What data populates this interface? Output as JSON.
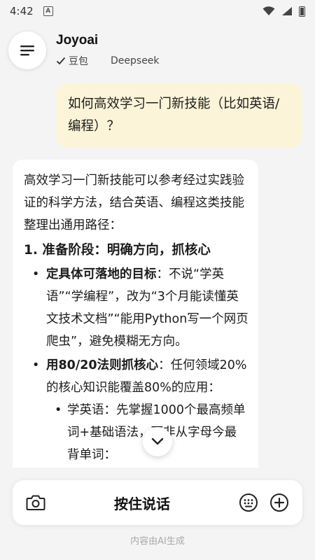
{
  "status_bar": {
    "time": "4:42",
    "notif_letter": "A"
  },
  "header": {
    "title": "Joyoai",
    "models": [
      {
        "label": "豆包",
        "selected": true
      },
      {
        "label": "Deepseek",
        "selected": false
      }
    ]
  },
  "conversation": {
    "user_message": "如何高效学习一门新技能（比如英语/编程）？",
    "ai": {
      "intro": "高效学习一门新技能可以参考经过实践验证的科学方法，结合英语、编程这类技能整理出通用路径：",
      "section1_title": "1. 准备阶段：明确方向，抓核心",
      "bullet1_bold": "定具体可落地的目标",
      "bullet1_text": "：不说“学英语”“学编程”，改为“3个月能读懂英文技术文档”“能用Python写一个网页爬虫”，避免模糊无方向。",
      "bullet2_bold": "用80/20法则抓核心",
      "bullet2_text": "：任何领域20%的核心知识能覆盖80%的应用：",
      "sub_bullet1": "学英语：先掌握1000个最高频单词+基础语法，而非从字母今最背单词："
    }
  },
  "input_bar": {
    "hold_to_talk": "按住说话"
  },
  "footer": {
    "note": "内容由AI生成"
  }
}
